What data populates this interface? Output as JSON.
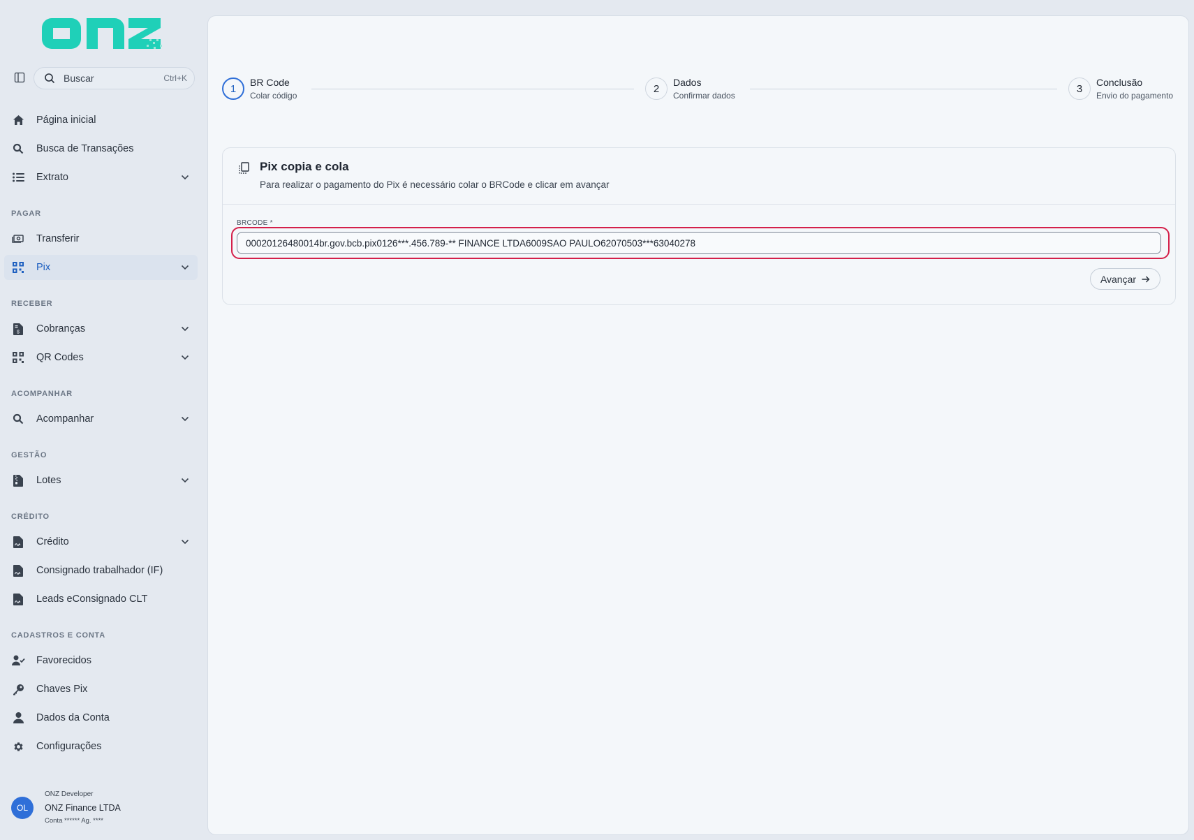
{
  "brand": {
    "name": "onz",
    "accent": "#1fd0b8",
    "primary": "#2f6fd8",
    "highlight": "#d4204a"
  },
  "search": {
    "placeholder": "Buscar",
    "shortcut": "Ctrl+K"
  },
  "sidebar": {
    "top_items": [
      {
        "label": "Página inicial",
        "icon": "home-icon"
      },
      {
        "label": "Busca de Transações",
        "icon": "search-icon"
      },
      {
        "label": "Extrato",
        "icon": "list-icon",
        "expandable": true
      }
    ],
    "sections": [
      {
        "label": "PAGAR",
        "items": [
          {
            "label": "Transferir",
            "icon": "money-transfer-icon"
          },
          {
            "label": "Pix",
            "icon": "pix-icon",
            "expandable": true,
            "active": true
          }
        ]
      },
      {
        "label": "RECEBER",
        "items": [
          {
            "label": "Cobranças",
            "icon": "invoice-icon",
            "expandable": true
          },
          {
            "label": "QR Codes",
            "icon": "qrcode-icon",
            "expandable": true
          }
        ]
      },
      {
        "label": "ACOMPANHAR",
        "items": [
          {
            "label": "Acompanhar",
            "icon": "search-icon",
            "expandable": true
          }
        ]
      },
      {
        "label": "GESTÃO",
        "items": [
          {
            "label": "Lotes",
            "icon": "file-zip-icon",
            "expandable": true
          }
        ]
      },
      {
        "label": "CRÉDITO",
        "items": [
          {
            "label": "Crédito",
            "icon": "file-signature-icon",
            "expandable": true
          },
          {
            "label": "Consignado trabalhador (IF)",
            "icon": "file-signature-icon"
          },
          {
            "label": "Leads eConsignado CLT",
            "icon": "file-signature-icon"
          }
        ]
      },
      {
        "label": "CADASTROS E CONTA",
        "items": [
          {
            "label": "Favorecidos",
            "icon": "user-check-icon"
          },
          {
            "label": "Chaves Pix",
            "icon": "key-icon"
          },
          {
            "label": "Dados da Conta",
            "icon": "user-icon"
          },
          {
            "label": "Configurações",
            "icon": "gear-icon"
          }
        ]
      }
    ]
  },
  "user": {
    "initials": "OL",
    "role": "ONZ Developer",
    "company": "ONZ Finance LTDA",
    "account": "Conta ****** Ag. ****"
  },
  "stepper": {
    "steps": [
      {
        "number": "1",
        "title": "BR Code",
        "subtitle": "Colar código",
        "active": true
      },
      {
        "number": "2",
        "title": "Dados",
        "subtitle": "Confirmar dados",
        "active": false
      },
      {
        "number": "3",
        "title": "Conclusão",
        "subtitle": "Envio do pagamento",
        "active": false
      }
    ]
  },
  "card": {
    "title": "Pix copia e cola",
    "description": "Para realizar o pagamento do Pix é necessário colar o BRCode e clicar em avançar",
    "field_label": "BRCODE *",
    "field_value": "00020126480014br.gov.bcb.pix0126***.456.789-** FINANCE LTDA6009SAO PAULO62070503***63040278",
    "submit_label": "Avançar"
  }
}
